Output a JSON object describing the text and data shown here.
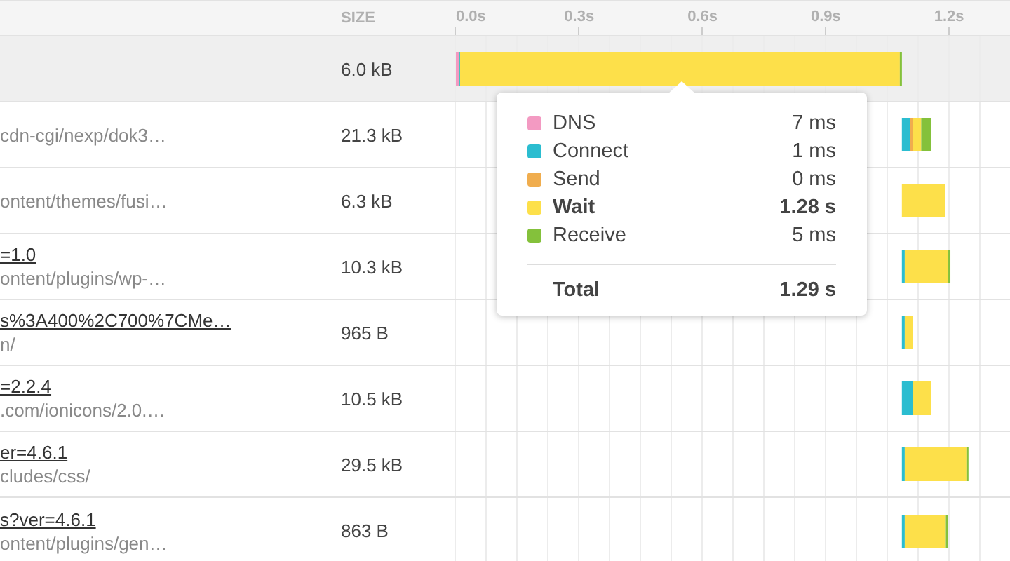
{
  "header": {
    "size_label": "SIZE"
  },
  "rows": [
    {
      "selected": true,
      "size": "6.0 kB"
    },
    {
      "selected": false,
      "path": "cdn-cgi/nexp/dok3…",
      "size": "21.3 kB"
    },
    {
      "selected": false,
      "path": "ontent/themes/fusi…",
      "size": "6.3 kB"
    },
    {
      "selected": false,
      "url": "=1.0",
      "path": "ontent/plugins/wp-…",
      "size": "10.3 kB"
    },
    {
      "selected": false,
      "url": "s%3A400%2C700%7CMe…",
      "path": "n/",
      "size": "965 B"
    },
    {
      "selected": false,
      "url": "=2.2.4",
      "path": ".com/ionicons/2.0.…",
      "size": "10.5 kB"
    },
    {
      "selected": false,
      "url": "er=4.6.1",
      "path": "cludes/css/",
      "size": "29.5 kB"
    },
    {
      "selected": false,
      "url": "s?ver=4.6.1",
      "path": "ontent/plugins/gen…",
      "size": "863 B"
    }
  ],
  "timeline": {
    "ticks": [
      "0.0s",
      "0.3s",
      "0.6s",
      "0.9s",
      "1.2s"
    ]
  },
  "tooltip": {
    "items": [
      {
        "label": "DNS",
        "value": "7 ms",
        "color": "#f39ac2",
        "bold": false
      },
      {
        "label": "Connect",
        "value": "1 ms",
        "color": "#2bbdd0",
        "bold": false
      },
      {
        "label": "Send",
        "value": "0 ms",
        "color": "#f0ad4e",
        "bold": false
      },
      {
        "label": "Wait",
        "value": "1.28 s",
        "color": "#fde04a",
        "bold": true
      },
      {
        "label": "Receive",
        "value": "5 ms",
        "color": "#84c13b",
        "bold": false
      }
    ],
    "total": {
      "label": "Total",
      "value": "1.29 s"
    }
  }
}
